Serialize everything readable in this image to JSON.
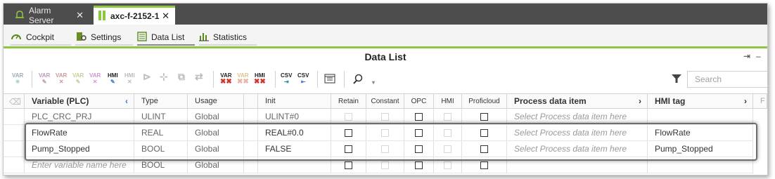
{
  "tabs": [
    {
      "label": "Alarm Server",
      "close": "✕"
    },
    {
      "label": "axc-f-2152-1",
      "close": "✕"
    }
  ],
  "nav": [
    {
      "label": "Cockpit"
    },
    {
      "label": "Settings"
    },
    {
      "label": "Data List"
    },
    {
      "label": "Statistics"
    }
  ],
  "title": "Data List",
  "pin_icon": "⇥",
  "minimize_icon": "–",
  "toolbar": {
    "var1": "VAR",
    "var2": "VAR",
    "var3": "VAR",
    "var4": "VAR",
    "var5": "VAR",
    "hmi1": "HMI",
    "hmi2": "HMI",
    "var_del1": "VAR",
    "var_del2": "VAR",
    "hmi_del": "HMI",
    "csv1": "CSV",
    "csv2": "CSV"
  },
  "search": {
    "placeholder": "Search"
  },
  "columns": {
    "variable": "Variable (PLC)",
    "type": "Type",
    "usage": "Usage",
    "init": "Init",
    "retain": "Retain",
    "constant": "Constant",
    "opc": "OPC",
    "hmi": "HMI",
    "proficloud": "Proficloud",
    "process_item": "Process data item",
    "hmi_tag": "HMI tag",
    "extra": "F"
  },
  "rows": [
    {
      "variable": "PLC_CRC_PRJ",
      "type": "ULINT",
      "usage": "Global",
      "init": "ULINT#0",
      "process_item": "Select Process data item here",
      "hmi_tag": ""
    },
    {
      "variable": "FlowRate",
      "type": "REAL",
      "usage": "Global",
      "init": "REAL#0.0",
      "process_item": "Select Process data item here",
      "hmi_tag": "FlowRate"
    },
    {
      "variable": "Pump_Stopped",
      "type": "BOOL",
      "usage": "Global",
      "init": "FALSE",
      "process_item": "Select Process data item here",
      "hmi_tag": "Pump_Stopped"
    },
    {
      "variable": "Enter variable name here",
      "type": "BOOL",
      "usage": "Global",
      "init": "",
      "process_item": "",
      "hmi_tag": ""
    }
  ],
  "colors": {
    "accent": "#8dc63f",
    "tabbar": "#4d4d4d",
    "delete_red": "#d0342c"
  }
}
